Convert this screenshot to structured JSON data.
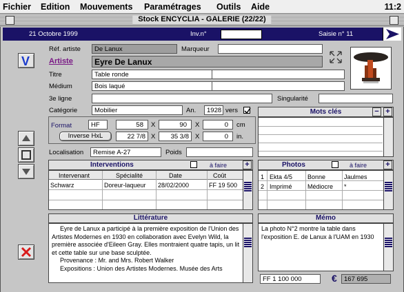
{
  "menubar": {
    "items": [
      "Fichier",
      "Edition",
      "Mouvements",
      "Paramétrages",
      "Outils",
      "Aide"
    ],
    "clock": "11:2"
  },
  "window": {
    "title": "Stock ENCYCLIA - GALERIE (22/22)"
  },
  "header": {
    "date": "21 Octobre 1999",
    "inv_label": "Inv.n°",
    "inv_value": "",
    "saisie": "Saisie n° 11"
  },
  "form": {
    "ref_artiste_label": "Réf. artiste",
    "ref_artiste_value": "De Lanux",
    "marqueur_label": "Marqueur",
    "marqueur_value": "",
    "artiste_label": "Artiste",
    "artiste_value": "Eyre De Lanux",
    "titre_label": "Titre",
    "titre_value": "Table ronde",
    "medium_label": "Médium",
    "medium_value": "Bois laqué",
    "ligne3_label": "3e ligne",
    "ligne3_value": "",
    "singularite_label": "Singularité",
    "singularite_value": "",
    "categorie_label": "Catégorie",
    "categorie_value": "Mobilier",
    "an_label": "An.",
    "an_value": "1928",
    "vers_label": "vers",
    "vers_checked": true,
    "format_label": "Format",
    "format_value": "HF",
    "dim_cm": [
      "58",
      "90",
      "0"
    ],
    "cm_label": "cm",
    "inverse_label": "Inverse HxL",
    "dim_in": [
      "22 7/8",
      "35 3/8",
      "0"
    ],
    "in_label": "in.",
    "x_label": "X",
    "localisation_label": "Localisation",
    "localisation_value": "Remise A-27",
    "poids_label": "Poids",
    "poids_value": ""
  },
  "mots_cles": {
    "title": "Mots clés"
  },
  "interventions": {
    "title": "Interventions",
    "a_faire": "à faire",
    "columns": [
      "Intervenant",
      "Spécialité",
      "Date",
      "Coût"
    ],
    "rows": [
      [
        "Schwarz",
        "Doreur-laqueur",
        "28/02/2000",
        "FF 19 500"
      ]
    ]
  },
  "photos": {
    "title": "Photos",
    "a_faire": "à faire",
    "rows": [
      [
        "1",
        "Ekta 4/5",
        "Bonne",
        "Jaulmes"
      ],
      [
        "2",
        "Imprimé",
        "Médiocre",
        "*"
      ]
    ]
  },
  "litterature": {
    "title": "Littérature",
    "paragraphs": [
      "Eyre de Lanux a participé à la première exposition de l'Union des Artistes Modernes en 1930 en collaboration avec Evelyn Wild, la première associée d'Eileen Gray. Elles montraient quatre tapis, un lit et cette table sur une base sculptée.",
      "Provenance : Mr. and Mrs. Robert Walker",
      "Expositions : Union des Artistes Modernes. Musée des Arts"
    ]
  },
  "memo": {
    "title": "Mémo",
    "text": "La photo N°2 montre la table dans l'exposition E. de Lanux à l'UAM en 1930"
  },
  "prices": {
    "ff_label": "FF",
    "ff_value": "1 100 000",
    "euro_label": "€",
    "euro_value": "167 695"
  },
  "colors": {
    "navy": "#1a1266",
    "purple": "#7a1a86",
    "red": "#d81a1a",
    "blue": "#1a3acc"
  }
}
